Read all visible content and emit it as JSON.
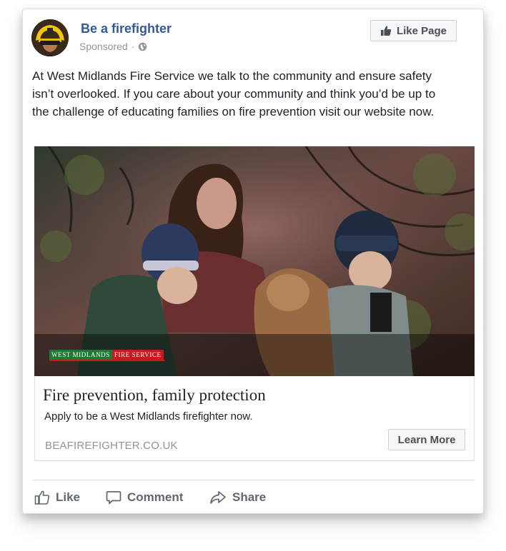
{
  "post": {
    "page_name": "Be a firefighter",
    "sponsored_label": "Sponsored",
    "separator": "·",
    "privacy_icon": "globe-icon",
    "like_page_label": "Like Page",
    "body_text": "At West Midlands Fire Service we talk to the community and ensure safety isn’t overlooked. If you care about your community and think you’d be up to the challenge of educating families on fire prevention visit our website now."
  },
  "ad": {
    "image_icon": "family-with-dog-photo",
    "logo": {
      "part1": "WEST MIDLANDS",
      "part2": "FIRE SERVICE"
    },
    "headline": "Fire prevention, family protection",
    "description": "Apply to be a West Midlands firefighter now.",
    "domain": "BEAFIREFIGHTER.CO.UK",
    "cta_label": "Learn More"
  },
  "actions": {
    "like": "Like",
    "comment": "Comment",
    "share": "Share"
  },
  "colors": {
    "link_blue": "#365899",
    "muted_grey": "#90949c",
    "button_text": "#4b4f56",
    "logo_green": "#1e7a33",
    "logo_red": "#c8191e"
  }
}
